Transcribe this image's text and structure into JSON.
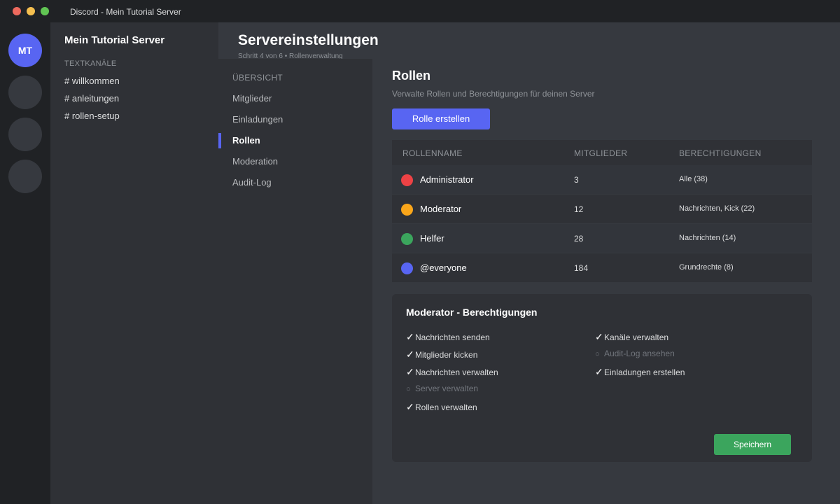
{
  "window": {
    "title": "Discord - Mein Tutorial Server"
  },
  "servers": {
    "active_initials": "MT"
  },
  "channels": {
    "server_name": "Mein Tutorial Server",
    "category": "TEXTKANÄLE",
    "items": [
      "# willkommen",
      "# anleitungen",
      "# rollen-setup"
    ]
  },
  "header": {
    "title": "Servereinstellungen",
    "subtitle": "Schritt 4 von 6 • Rollenverwaltung"
  },
  "settings_nav": {
    "header": "ÜBERSICHT",
    "items": [
      "Mitglieder",
      "Einladungen",
      "Rollen",
      "Moderation",
      "Audit-Log"
    ],
    "active": "Rollen"
  },
  "roles": {
    "title": "Rollen",
    "subtitle": "Verwalte Rollen und Berechtigungen für deinen Server",
    "create_label": "Rolle erstellen",
    "columns": [
      "ROLLENNAME",
      "MITGLIEDER",
      "BERECHTIGUNGEN"
    ],
    "rows": [
      {
        "name": "Administrator",
        "members": "3",
        "perms": "Alle (38)",
        "color": "#ed4245"
      },
      {
        "name": "Moderator",
        "members": "12",
        "perms": "Nachrichten, Kick (22)",
        "color": "#faa61a"
      },
      {
        "name": "Helfer",
        "members": "28",
        "perms": "Nachrichten (14)",
        "color": "#3ba55d"
      },
      {
        "name": "@everyone",
        "members": "184",
        "perms": "Grundrechte (8)",
        "color": "#5865f2"
      }
    ]
  },
  "permissions": {
    "title": "Moderator - Berechtigungen",
    "left": [
      {
        "label": "Nachrichten senden",
        "enabled": true
      },
      {
        "label": "Mitglieder kicken",
        "enabled": true
      },
      {
        "label": "Nachrichten verwalten",
        "enabled": true
      },
      {
        "label": "Server verwalten",
        "enabled": false
      },
      {
        "label": "Rollen verwalten",
        "enabled": true
      }
    ],
    "right": [
      {
        "label": "Kanäle verwalten",
        "enabled": true
      },
      {
        "label": "Audit-Log ansehen",
        "enabled": false
      },
      {
        "label": "Einladungen erstellen",
        "enabled": true
      }
    ],
    "save_label": "Speichern"
  },
  "colors": {
    "accent": "#5865f2",
    "success": "#3ba55d",
    "background": "#36393f",
    "sidebar": "#2f3136",
    "rail": "#202225"
  }
}
